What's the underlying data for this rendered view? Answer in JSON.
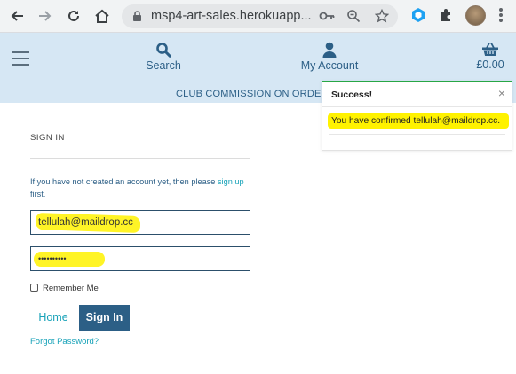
{
  "browser": {
    "url": "msp4-art-sales.herokuapp...",
    "back_icon": "back-arrow-icon",
    "forward_icon": "forward-arrow-icon",
    "reload_icon": "reload-icon",
    "home_icon": "home-icon"
  },
  "header": {
    "search_label": "Search",
    "account_label": "My Account",
    "bag_total": "£0.00",
    "commission_text": "CLUB COMMISSION ON ORDER"
  },
  "signin": {
    "title": "SIGN IN",
    "helper_prefix": "If you have not created an account yet, then please ",
    "helper_link": "sign up",
    "helper_suffix": " first.",
    "email_value": "tellulah@maildrop.cc",
    "password_value": "••••••••••",
    "remember_label": "Remember Me",
    "home_button": "Home",
    "signin_button": "Sign In",
    "forgot_link": "Forgot Password?"
  },
  "toast": {
    "title": "Success!",
    "close": "×",
    "message": "You have confirmed tellulah@maildrop.cc."
  },
  "colors": {
    "brand": "#2c5f86",
    "header_bg": "#d6e7f4",
    "link": "#17a2b8",
    "highlight": "#fff200",
    "success": "#28a745"
  }
}
